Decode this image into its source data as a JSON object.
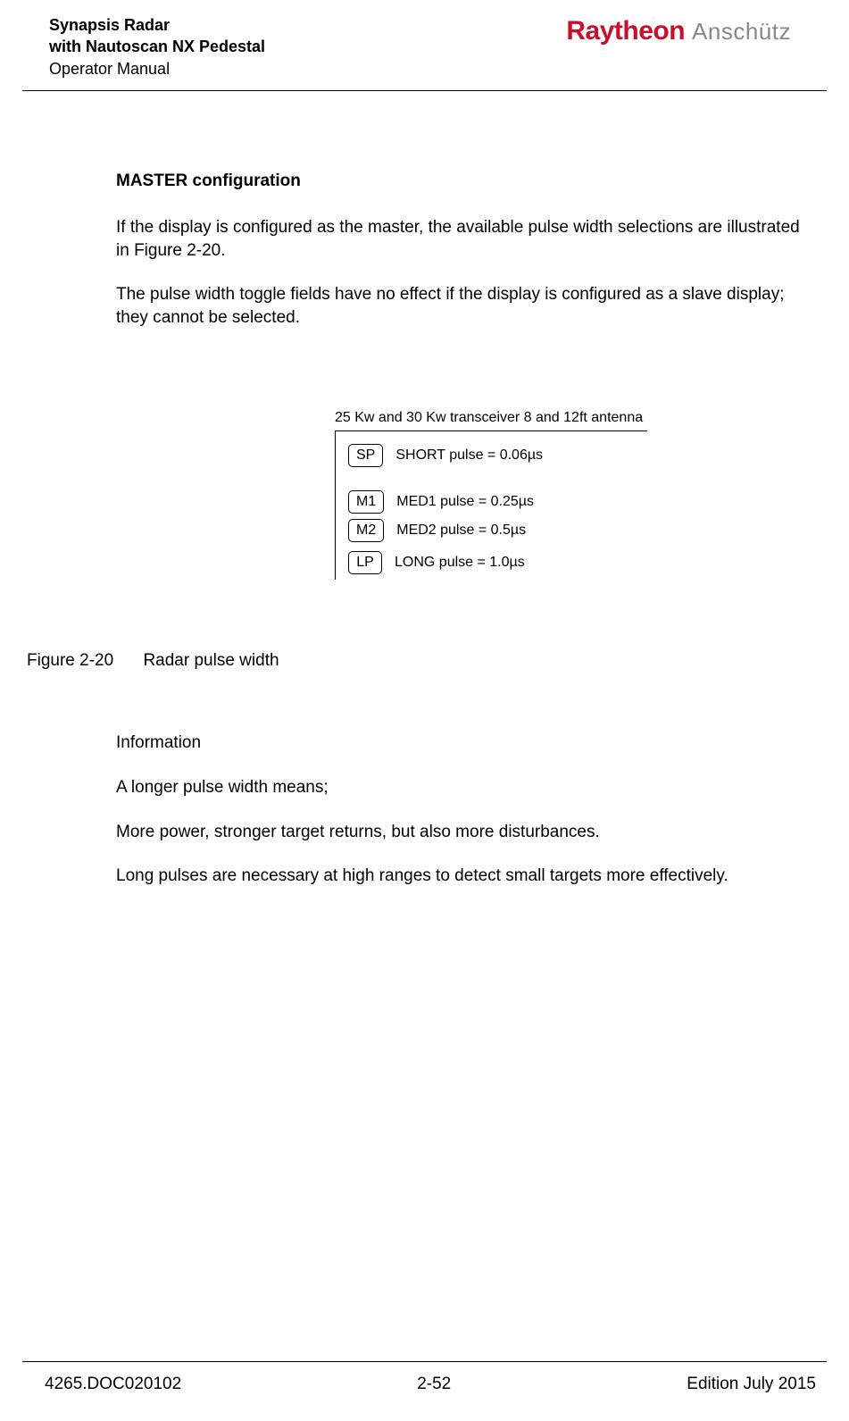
{
  "header": {
    "title_line1": "Synapsis Radar",
    "title_line2": "with Nautoscan NX Pedestal",
    "title_line3": "Operator Manual",
    "brand_part1": "Raytheon",
    "brand_part2": "Anschütz"
  },
  "section": {
    "title": "MASTER configuration",
    "para1": "If the display is configured as the master, the available pulse width selections are illustrated in Figure 2-20.",
    "para2": "The pulse width toggle fields have no effect if the display is configured as a slave display; they cannot be selected."
  },
  "diagram": {
    "caption": "25 Kw and 30 Kw transceiver 8 and 12ft antenna",
    "rows": {
      "sp": {
        "btn": "SP",
        "label": "SHORT pulse = 0.06µs"
      },
      "m1": {
        "btn": "M1",
        "label": "MED1 pulse = 0.25µs"
      },
      "m2": {
        "btn": "M2",
        "label": "MED2 pulse = 0.5µs"
      },
      "lp": {
        "btn": "LP",
        "label": "LONG pulse = 1.0µs"
      }
    }
  },
  "figure": {
    "number": "Figure 2-20",
    "title": "Radar pulse width"
  },
  "info": {
    "heading": "Information",
    "line1": "A longer pulse width means;",
    "line2": "More power, stronger target returns, but also more disturbances.",
    "line3": "Long pulses are necessary at high ranges to detect small targets more effectively."
  },
  "footer": {
    "left": "4265.DOC020102",
    "center": "2-52",
    "right": "Edition July 2015"
  }
}
